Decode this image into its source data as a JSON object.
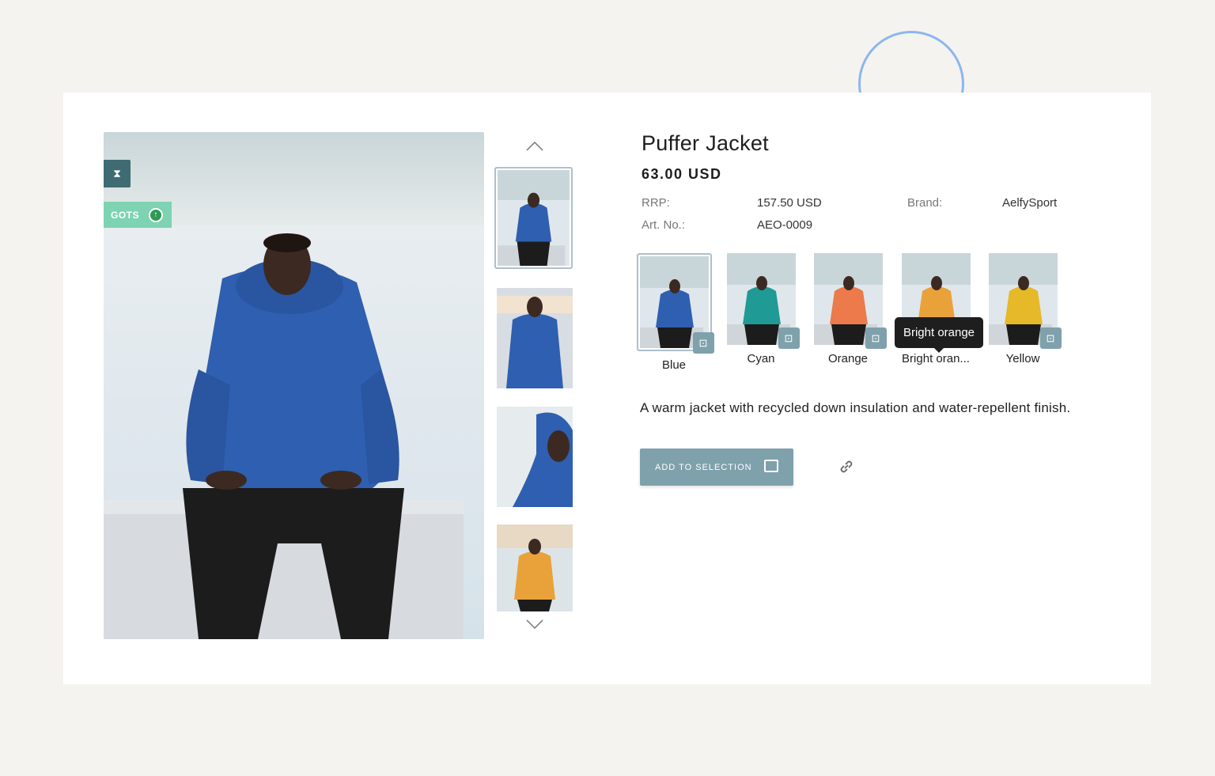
{
  "product": {
    "title": "Puffer Jacket",
    "price": "63.00 USD",
    "rrp_label": "RRP:",
    "rrp_value": "157.50 USD",
    "brand_label": "Brand:",
    "brand_value": "AelfySport",
    "art_label": "Art. No.:",
    "art_value": "AEO-0009",
    "description": "A warm jacket with recycled down insulation and water-repellent finish."
  },
  "badges": {
    "hourglass_icon": "hourglass-icon",
    "gots_label": "GOTS"
  },
  "variants": [
    {
      "label": "Blue",
      "color": "#2f5fb0",
      "selected": true
    },
    {
      "label": "Cyan",
      "color": "#1f9a95",
      "selected": false
    },
    {
      "label": "Orange",
      "color": "#ec7a4a",
      "selected": false
    },
    {
      "label": "Bright oran...",
      "color": "#e9a23a",
      "selected": false
    },
    {
      "label": "Yellow",
      "color": "#e6b928",
      "selected": false
    }
  ],
  "tooltip": "Bright orange",
  "actions": {
    "add_to_selection": "ADD TO SELECTION",
    "link_icon": "link-icon"
  },
  "colors": {
    "accent": "#7fa1ac",
    "background": "#f5f3ef",
    "tooltip_bg": "#1e1e1e",
    "decor_circle": "#8cb6ee",
    "gots_badge": "#7dd3b2",
    "hourglass_badge": "#3f6b73"
  }
}
